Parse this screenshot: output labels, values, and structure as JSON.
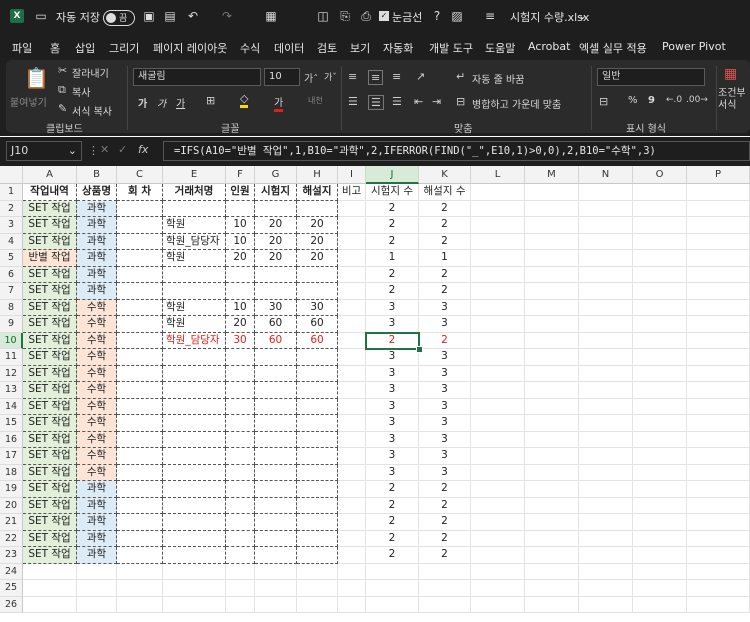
{
  "titlebar": {
    "autosave_label": "자동 저장",
    "autosave_state": "끔",
    "gridlines_label": "눈금선",
    "filename": "시험지 수량.xlsx"
  },
  "menu": [
    "파일",
    "홈",
    "삽입",
    "그리기",
    "페이지 레이아웃",
    "수식",
    "데이터",
    "검토",
    "보기",
    "자동화",
    "개발 도구",
    "도움말",
    "Acrobat",
    "엑셀 실무 적용",
    "Power Pivot"
  ],
  "ribbon": {
    "paste": "붙여넣기",
    "cut": "잘라내기",
    "copy": "복사",
    "format_painter": "서식 복사",
    "clipboard_group": "클립보드",
    "font_name": "새굴림",
    "font_size": "10",
    "bold": "가",
    "italic": "가",
    "underline": "가",
    "font_color": "가",
    "phonetic": "내천",
    "font_group": "글꼴",
    "wrap_text": "자동 줄 바꿈",
    "merge_center": "병합하고 가운데 맞춤",
    "align_group": "맞춤",
    "number_format": "일반",
    "percent": "%",
    "comma": "9",
    "number_group": "표시 형식",
    "conditional": "조건부 서식"
  },
  "formula_bar": {
    "name_box": "J10",
    "fx": "fx",
    "formula": "=IFS(A10=\"반별 작업\",1,B10=\"과학\",2,IFERROR(FIND(\"_\",E10,1)>0,0),2,B10=\"수학\",3)"
  },
  "columns": [
    "A",
    "B",
    "C",
    "E",
    "F",
    "G",
    "H",
    "I",
    "J",
    "K",
    "L",
    "M",
    "N",
    "O",
    "P"
  ],
  "headers": {
    "A": "작업내역",
    "B": "상품명",
    "C": "회 차",
    "E": "거래처명",
    "F": "인원",
    "G": "시험지",
    "H": "해설지",
    "I": "비고",
    "J": "시험지 수",
    "K": "해설지 수"
  },
  "rows": [
    {
      "A": "SET 작업",
      "B": "과학",
      "E": "",
      "F": "",
      "G": "",
      "H": "",
      "J": "2",
      "K": "2"
    },
    {
      "A": "SET 작업",
      "B": "과학",
      "E": "학원",
      "F": "10",
      "G": "20",
      "H": "20",
      "J": "2",
      "K": "2"
    },
    {
      "A": "SET 작업",
      "B": "과학",
      "E": "학원_담당자",
      "F": "10",
      "G": "20",
      "H": "20",
      "J": "2",
      "K": "2"
    },
    {
      "A": "반별 작업",
      "B": "과학",
      "E": "학원",
      "F": "20",
      "G": "20",
      "H": "20",
      "J": "1",
      "K": "1"
    },
    {
      "A": "SET 작업",
      "B": "과학",
      "E": "",
      "F": "",
      "G": "",
      "H": "",
      "J": "2",
      "K": "2"
    },
    {
      "A": "SET 작업",
      "B": "과학",
      "E": "",
      "F": "",
      "G": "",
      "H": "",
      "J": "2",
      "K": "2"
    },
    {
      "A": "SET 작업",
      "B": "수학",
      "E": "학원",
      "F": "10",
      "G": "30",
      "H": "30",
      "J": "3",
      "K": "3"
    },
    {
      "A": "SET 작업",
      "B": "수학",
      "E": "학원",
      "F": "20",
      "G": "60",
      "H": "60",
      "J": "3",
      "K": "3"
    },
    {
      "A": "SET 작업",
      "B": "수학",
      "E": "학원_담당자",
      "F": "30",
      "G": "60",
      "H": "60",
      "J": "2",
      "K": "2"
    },
    {
      "A": "SET 작업",
      "B": "수학",
      "E": "",
      "F": "",
      "G": "",
      "H": "",
      "J": "3",
      "K": "3"
    },
    {
      "A": "SET 작업",
      "B": "수학",
      "E": "",
      "F": "",
      "G": "",
      "H": "",
      "J": "3",
      "K": "3"
    },
    {
      "A": "SET 작업",
      "B": "수학",
      "E": "",
      "F": "",
      "G": "",
      "H": "",
      "J": "3",
      "K": "3"
    },
    {
      "A": "SET 작업",
      "B": "수학",
      "E": "",
      "F": "",
      "G": "",
      "H": "",
      "J": "3",
      "K": "3"
    },
    {
      "A": "SET 작업",
      "B": "수학",
      "E": "",
      "F": "",
      "G": "",
      "H": "",
      "J": "3",
      "K": "3"
    },
    {
      "A": "SET 작업",
      "B": "수학",
      "E": "",
      "F": "",
      "G": "",
      "H": "",
      "J": "3",
      "K": "3"
    },
    {
      "A": "SET 작업",
      "B": "수학",
      "E": "",
      "F": "",
      "G": "",
      "H": "",
      "J": "3",
      "K": "3"
    },
    {
      "A": "SET 작업",
      "B": "수학",
      "E": "",
      "F": "",
      "G": "",
      "H": "",
      "J": "3",
      "K": "3"
    },
    {
      "A": "SET 작업",
      "B": "과학",
      "E": "",
      "F": "",
      "G": "",
      "H": "",
      "J": "2",
      "K": "2"
    },
    {
      "A": "SET 작업",
      "B": "과학",
      "E": "",
      "F": "",
      "G": "",
      "H": "",
      "J": "2",
      "K": "2"
    },
    {
      "A": "SET 작업",
      "B": "과학",
      "E": "",
      "F": "",
      "G": "",
      "H": "",
      "J": "2",
      "K": "2"
    },
    {
      "A": "SET 작업",
      "B": "과학",
      "E": "",
      "F": "",
      "G": "",
      "H": "",
      "J": "2",
      "K": "2"
    },
    {
      "A": "SET 작업",
      "B": "과학",
      "E": "",
      "F": "",
      "G": "",
      "H": "",
      "J": "2",
      "K": "2"
    }
  ],
  "row_numbers": [
    "1",
    "2",
    "3",
    "4",
    "5",
    "6",
    "7",
    "8",
    "9",
    "10",
    "11",
    "12",
    "13",
    "14",
    "15",
    "16",
    "17",
    "18",
    "19",
    "20",
    "21",
    "22",
    "23",
    "24",
    "25",
    "26"
  ],
  "selected_cell": "J10",
  "colors": {
    "set_fill": "#e2efda",
    "math_fill": "#fce4d6",
    "science_fill": "#ddebf7",
    "highlight_text": "#e02020",
    "selection": "#217346"
  }
}
